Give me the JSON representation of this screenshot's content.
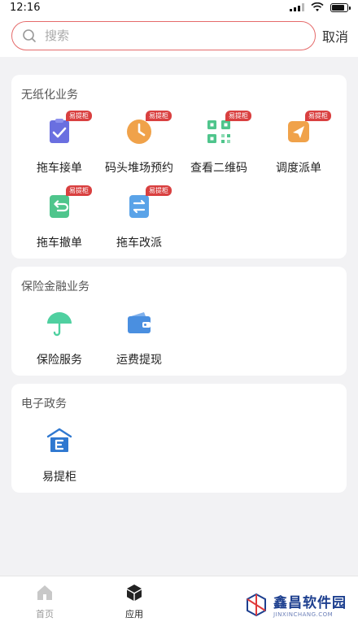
{
  "status": {
    "time": "12:16"
  },
  "search": {
    "placeholder": "搜索",
    "cancel_label": "取消"
  },
  "sections": [
    {
      "title": "无纸化业务",
      "items": [
        {
          "label": "拖车接单",
          "icon": "clipboard-check-icon",
          "badge": "易提柜",
          "color": "#6a6fe0"
        },
        {
          "label": "码头堆场预约",
          "icon": "clock-icon",
          "badge": "易提柜",
          "color": "#f0a24a"
        },
        {
          "label": "查看二维码",
          "icon": "qr-code-icon",
          "badge": "易提柜",
          "color": "#4fc58c"
        },
        {
          "label": "调度派单",
          "icon": "send-icon",
          "badge": "易提柜",
          "color": "#f0a24a"
        },
        {
          "label": "拖车撤单",
          "icon": "undo-document-icon",
          "badge": "易提柜",
          "color": "#4fc58c"
        },
        {
          "label": "拖车改派",
          "icon": "swap-document-icon",
          "badge": "易提柜",
          "color": "#5aa3e8"
        }
      ]
    },
    {
      "title": "保险金融业务",
      "items": [
        {
          "label": "保险服务",
          "icon": "umbrella-icon",
          "color": "#4fd0a0"
        },
        {
          "label": "运费提现",
          "icon": "wallet-icon",
          "color": "#4a8fe0"
        }
      ]
    },
    {
      "title": "电子政务",
      "items": [
        {
          "label": "易提柜",
          "icon": "e-house-icon",
          "color": "#2f78d0"
        }
      ]
    }
  ],
  "tabs": [
    {
      "label": "首页",
      "icon": "home-icon",
      "active": false
    },
    {
      "label": "应用",
      "icon": "cube-icon",
      "active": true
    }
  ],
  "watermark": {
    "title": "鑫昌软件园",
    "subtitle": "JINXINCHANG.COM"
  }
}
